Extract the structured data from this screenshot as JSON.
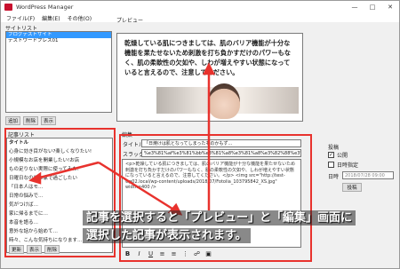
{
  "window": {
    "title": "WordPress Manager"
  },
  "menu": {
    "file": "ファイル(F)",
    "edit": "編集(E)",
    "other": "その他(O)"
  },
  "site_list": {
    "label": "サイトリスト",
    "items": [
      "ブログテストサイト",
      "テストワードプレス01"
    ]
  },
  "site_buttons": {
    "add": "追加",
    "delete": "削除",
    "show": "表示"
  },
  "article_list": {
    "label": "記事リスト",
    "header": "タイトル",
    "items": [
      "心身に効き目がない?楽しくなりたい!",
      "小規模なお店を開業したい!お店",
      "もの足りない実際に使ってみた!",
      "日曜日なのでお家で過ごしたい",
      "「日本人はモ…",
      "日常の悩みで…",
      "気がつけば…",
      "家に帰るまでに…",
      "本音を語る…",
      "意外な話から始めて…",
      "時々、こんな気持ちになります…",
      "色んなものについて考えてみた…"
    ]
  },
  "article_buttons": {
    "update": "更新",
    "show": "表示",
    "delete": "削除"
  },
  "preview": {
    "label": "プレビュー",
    "text": "乾燥している肌につきましては、肌のバリア機能が十分な機能を果たせないため刺激を打ち負かすだけのパワーもなく、肌の柔軟性の欠如や、しわが増えやすい状態になっていると言えるので、注意してください。"
  },
  "edit": {
    "label": "編集",
    "title_label": "タイトル",
    "title_value": "「日焼けは肌となってしまったものかもず…",
    "slug_label": "スラッグ",
    "slug_value": "%e3%81%af%e3%81%bb%e3%81%a8%e3%81%a8%e3%82%88%e3%81%a8",
    "body": "<p>乾燥している肌につきましては、肌のバリア機能が十分な機能を果たせないため刺激を打ち負かすだけのパワーもなく、肌の柔軟性の欠如や、しわが増えやすい状態になっていると言えるので、注意してください。</p> <img src=\"http://test-wp02.local/wp-content/uploads/2018/07/Fotolia_103795842_XS.jpg\" width=400 />"
  },
  "publish": {
    "label": "投稿",
    "public": "公開",
    "schedule": "日時指定",
    "datetime_label": "日時",
    "datetime_value": "2018/07/28 09:00",
    "post_button": "投稿"
  },
  "caption": {
    "line1": "記事を選択すると「プレビュー」と「編集」画面に",
    "line2": "選択した記事が表示されます。"
  },
  "colors": {
    "highlight": "#e8322d",
    "selection": "#3399ff"
  }
}
